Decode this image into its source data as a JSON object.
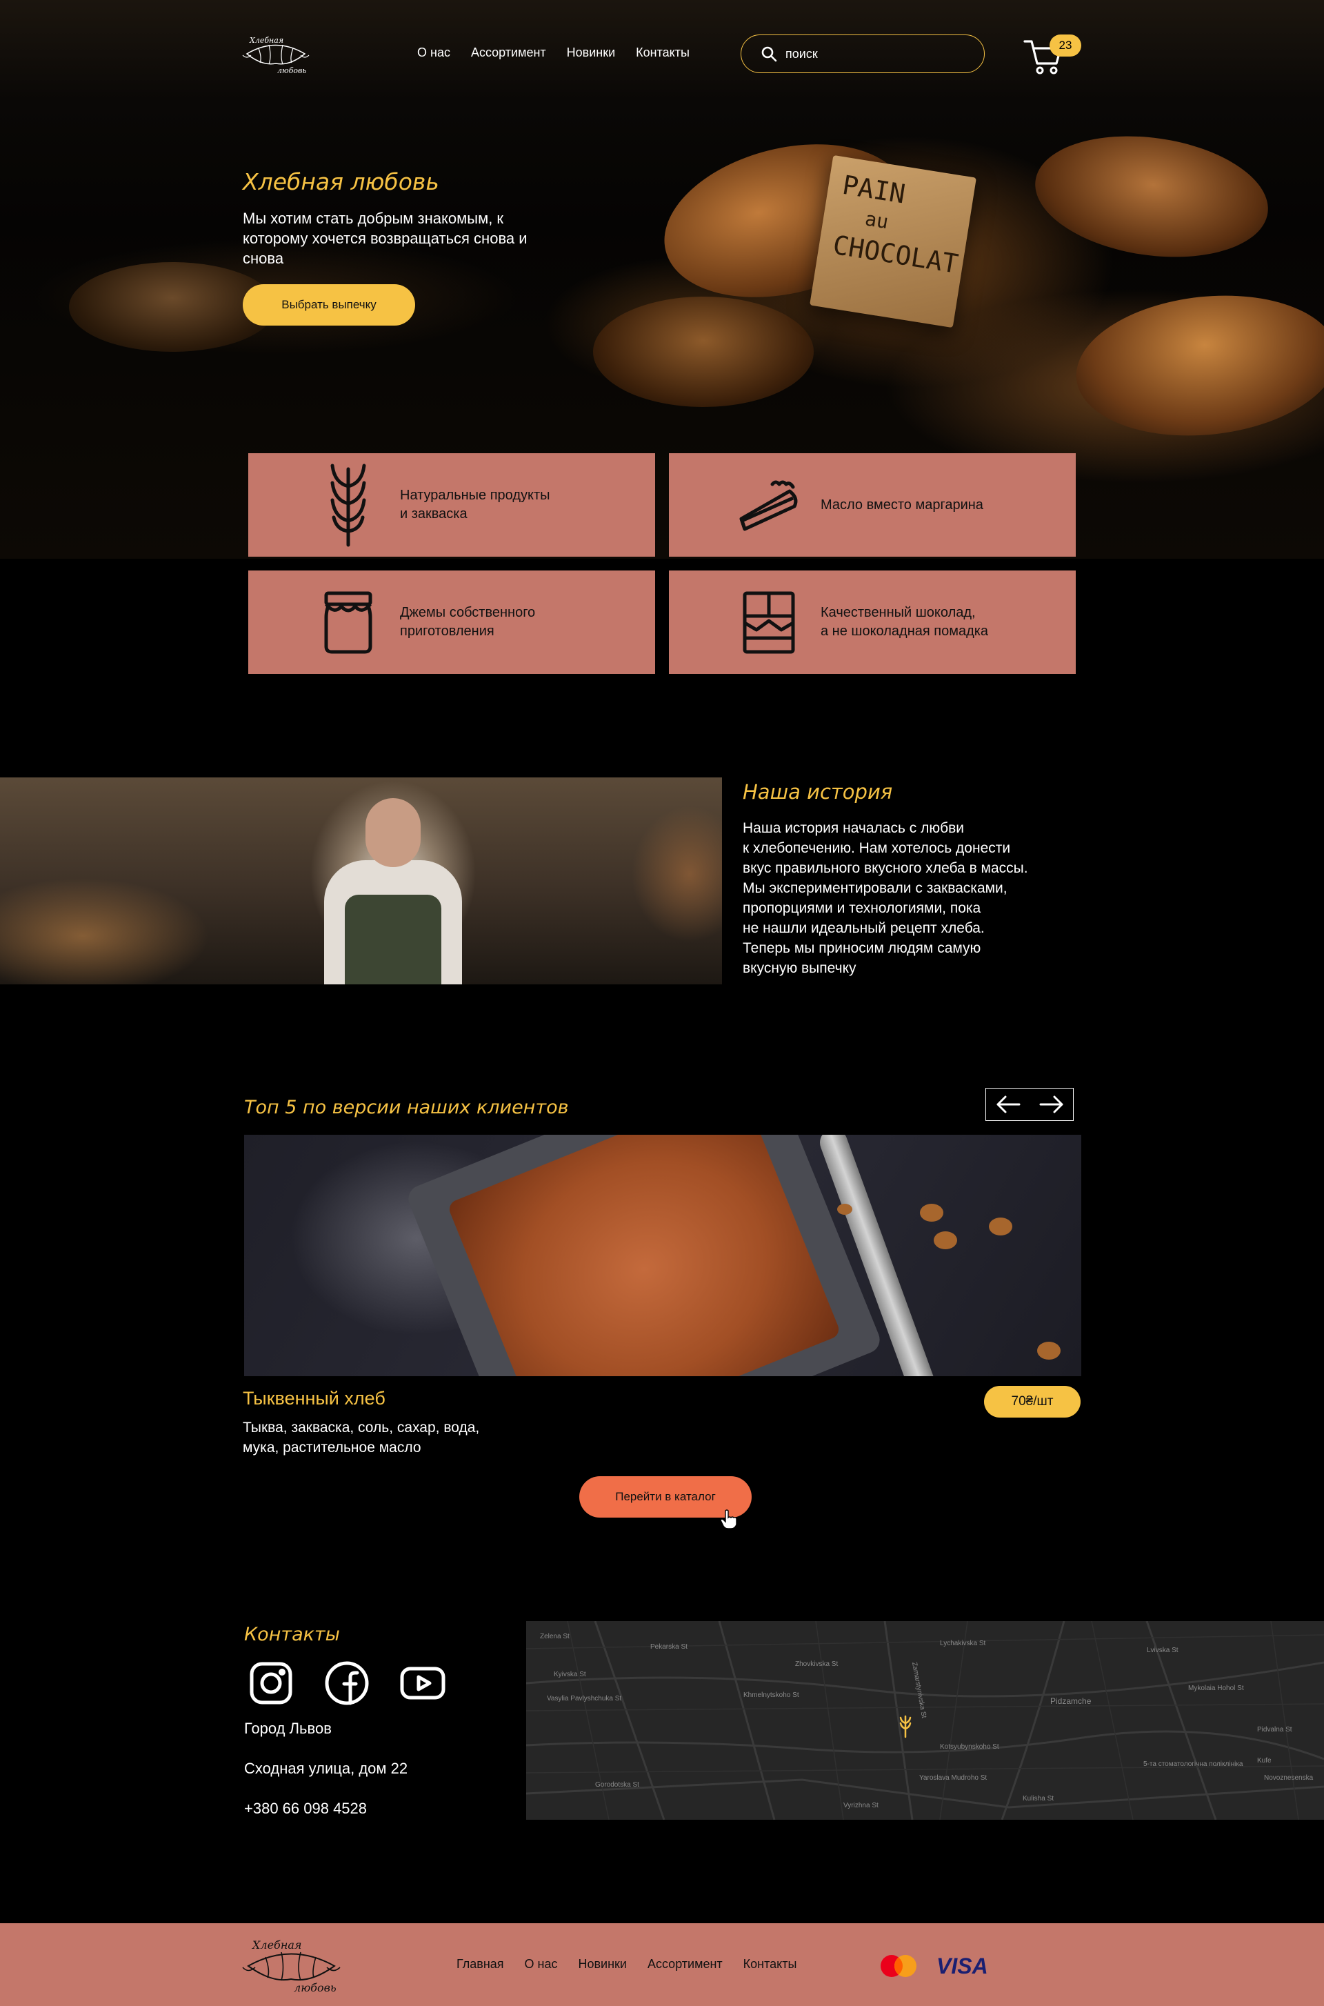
{
  "brand": {
    "logo_line1": "Хлебная",
    "logo_line2": "любовь",
    "accent": "#f6c244",
    "feature_color": "#c4776a",
    "cta_color": "#f06e48"
  },
  "nav": {
    "items": [
      "О нас",
      "Ассортимент",
      "Новинки",
      "Контакты"
    ]
  },
  "search": {
    "placeholder": "поиск",
    "icon": "search-icon"
  },
  "cart": {
    "count": "23",
    "icon": "cart-icon"
  },
  "hero": {
    "title": "Хлебная любовь",
    "text": "Мы хотим стать добрым знакомым, к которому хочется возвращаться снова и снова",
    "button": "Выбрать выпечку",
    "sign": [
      "PAIN",
      "au",
      "CHOCOLAT"
    ]
  },
  "features": [
    {
      "icon": "wheat-icon",
      "text": "Натуральные продукты\nи закваска"
    },
    {
      "icon": "pie-icon",
      "text": "Масло вместо маргарина"
    },
    {
      "icon": "jam-jar-icon",
      "text": "Джемы собственного\nприготовления"
    },
    {
      "icon": "chocolate-icon",
      "text": "Качественный шоколад,\nа не шоколадная помадка"
    }
  ],
  "story": {
    "title": "Наша история",
    "text": "Наша история началась с любви\nк хлебопечению. Нам хотелось донести\nвкус правильного вкусного хлеба в массы.\nМы экспериментировали с заквасками,\nпропорциями и технологиями, пока\nне нашли идеальный рецепт хлеба.\nТеперь мы приносим людям самую\nвкусную выпечку"
  },
  "top5": {
    "title": "Топ 5 по версии наших клиентов",
    "product": {
      "name": "Тыквенный хлеб",
      "description": "Тыква, закваска, соль, сахар, вода,\nмука, растительное масло",
      "price": "70₴/шт"
    },
    "catalog_button": "Перейти в каталог"
  },
  "contacts": {
    "title": "Контакты",
    "social": [
      "instagram-icon",
      "facebook-icon",
      "youtube-icon"
    ],
    "city": "Город Львов",
    "address": "Сходная улица, дом 22",
    "phone": "+380 66 098 4528"
  },
  "map": {
    "labels": [
      "Zelena St",
      "Pekarska St",
      "Pidzamche",
      "Kyivska St",
      "Vasylia Pavlyshchuka St",
      "Velykoho St",
      "Zhovkivska St",
      "Khmelnytskoho St",
      "Lychakivska St",
      "Ursuly St",
      "Zamarstynivska St",
      "Pidzamche",
      "5-та стоматологічна поліклініка",
      "Kotsyubynskoho St",
      "Pidvalna St",
      "Gorodotska St",
      "Yaroslava Mudroho St",
      "Vitovskoho St",
      "Dorozhyntsia St",
      "Kufe",
      "Novoznesenska",
      "Lvivska St",
      "Vyrizhna St",
      "Kulisha St",
      "Mykolaia Hohol St"
    ]
  },
  "footer": {
    "nav": [
      "Главная",
      "О нас",
      "Новинки",
      "Ассортимент",
      "Контакты"
    ],
    "payments": [
      "mastercard-icon",
      "VISA"
    ]
  }
}
